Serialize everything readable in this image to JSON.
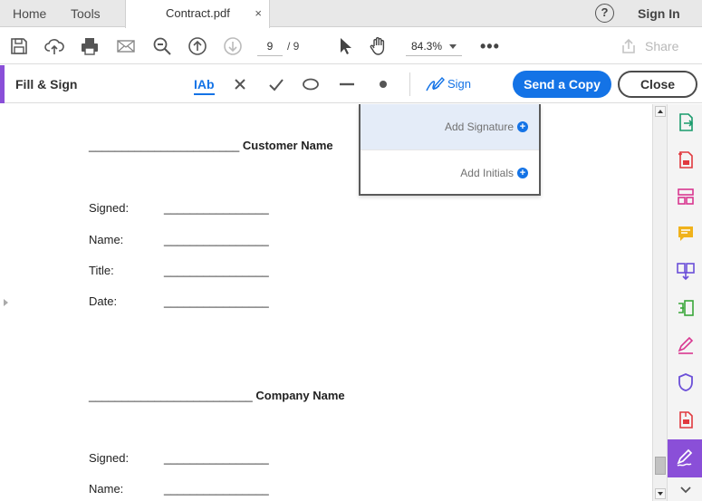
{
  "tabbar": {
    "home_label": "Home",
    "tools_label": "Tools",
    "document_tab": "Contract.pdf",
    "close_glyph": "×",
    "help_glyph": "?",
    "signin_label": "Sign In"
  },
  "toolbar": {
    "icons": [
      "save-icon",
      "upload-cloud-icon",
      "print-icon",
      "email-icon",
      "zoom-out-icon",
      "page-up-icon",
      "page-down-icon",
      "select-arrow-icon",
      "hand-icon",
      "more-icon"
    ],
    "current_page": "9",
    "page_total": "/ 9",
    "zoom": "84.3%",
    "more_glyph": "•••",
    "share_label": "Share"
  },
  "fill_sign": {
    "title": "Fill & Sign",
    "tools": [
      "text-tool-icon",
      "cross-mark-icon",
      "check-mark-icon",
      "ellipse-icon",
      "line-icon",
      "dot-icon"
    ],
    "text_tool_glyph": "IAb",
    "sign_label": "Sign",
    "send_copy_label": "Send a Copy",
    "close_label": "Close",
    "accent_color": "#8a4fd8",
    "primary_color": "#1473e6"
  },
  "sign_menu": {
    "items": [
      {
        "label": "Add Signature",
        "plus": "+"
      },
      {
        "label": "Add Initials",
        "plus": "+"
      }
    ]
  },
  "document": {
    "customer_line": "_______________________",
    "customer_label": "Customer Name",
    "company_line": "_________________________",
    "company_label": "Company Name",
    "blank": "________________",
    "section1": [
      "Signed:",
      "Name:",
      "Title:",
      "Date:"
    ],
    "section2": [
      "Signed:",
      "Name:"
    ]
  },
  "right_panel": {
    "icons": [
      "export-pdf-icon",
      "create-pdf-icon",
      "edit-pdf-icon",
      "comment-icon",
      "combine-files-icon",
      "organize-pages-icon",
      "fill-sign-icon",
      "protect-icon",
      "compress-pdf-icon",
      "sign-active-icon"
    ]
  }
}
